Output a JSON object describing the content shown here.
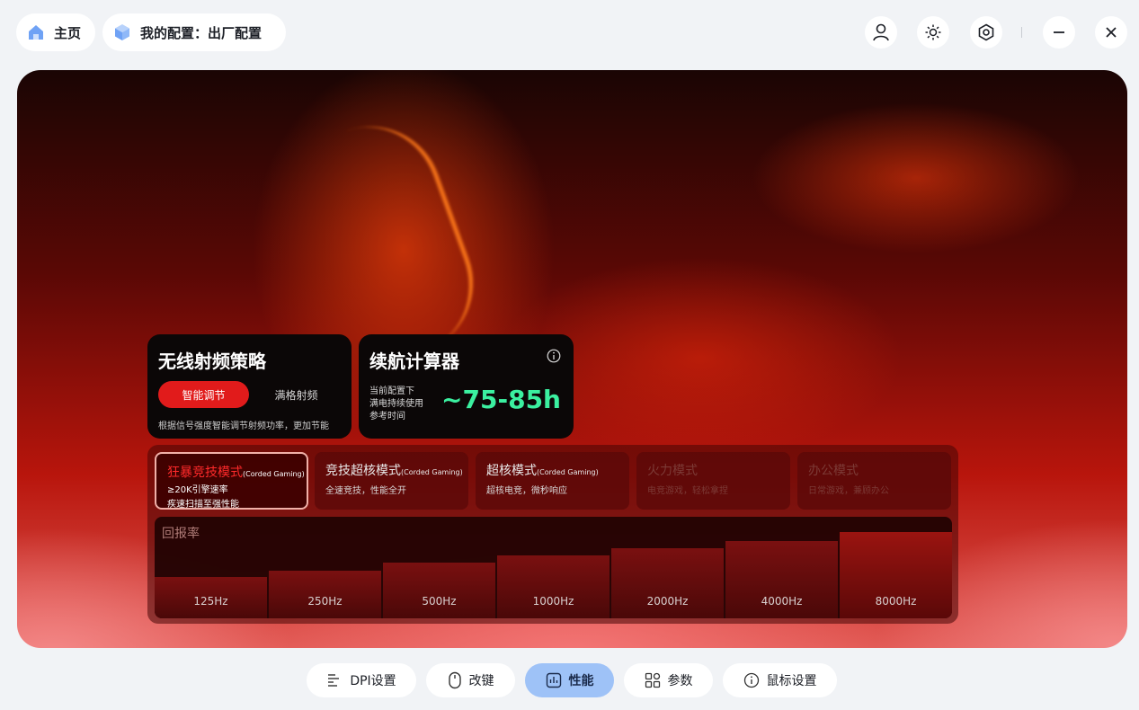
{
  "header": {
    "home_label": "主页",
    "config_label": "我的配置：出厂配置",
    "icons": [
      "user-icon",
      "brightness-icon",
      "settings-hex-icon",
      "minimize-icon",
      "close-icon"
    ]
  },
  "wireless": {
    "title": "无线射频策略",
    "option_active": "智能调节",
    "option_other": "满格射频",
    "description": "根据信号强度智能调节射频功率，更加节能"
  },
  "battery": {
    "title": "续航计算器",
    "line1": "当前配置下",
    "line2": "满电持续使用",
    "line3": "参考时间",
    "value": "~75-85h",
    "value_color": "#3bf0a0"
  },
  "modes": [
    {
      "name": "狂暴竞技模式",
      "tag": "(Corded Gaming)",
      "desc1": "≥20K引擎速率",
      "desc2": "疾速扫描至强性能",
      "state": "active"
    },
    {
      "name": "竞技超核模式",
      "tag": "(Corded Gaming)",
      "desc1": "全速竞技，性能全开",
      "state": "normal"
    },
    {
      "name": "超核模式",
      "tag": "(Corded Gaming)",
      "desc1": "超核电竞，微秒响应",
      "state": "normal"
    },
    {
      "name": "火力模式",
      "tag": "",
      "desc1": "电竞游戏，轻松拿捏",
      "state": "dim"
    },
    {
      "name": "办公模式",
      "tag": "",
      "desc1": "日常游戏，兼顾办公",
      "state": "dim"
    }
  ],
  "polling": {
    "title": "回报率",
    "rates": [
      "125Hz",
      "250Hz",
      "500Hz",
      "1000Hz",
      "2000Hz",
      "4000Hz",
      "8000Hz"
    ]
  },
  "nav": {
    "items": [
      {
        "label": "DPI设置",
        "icon": "dpi-icon"
      },
      {
        "label": "改键",
        "icon": "mouse-icon"
      },
      {
        "label": "性能",
        "icon": "performance-icon",
        "active": true
      },
      {
        "label": "参数",
        "icon": "grid-icon"
      },
      {
        "label": "鼠标设置",
        "icon": "info-icon"
      }
    ],
    "active_color": "#9ec2f7"
  },
  "colors": {
    "accent_red": "#e11b1b",
    "battery_green": "#3bf0a0"
  }
}
